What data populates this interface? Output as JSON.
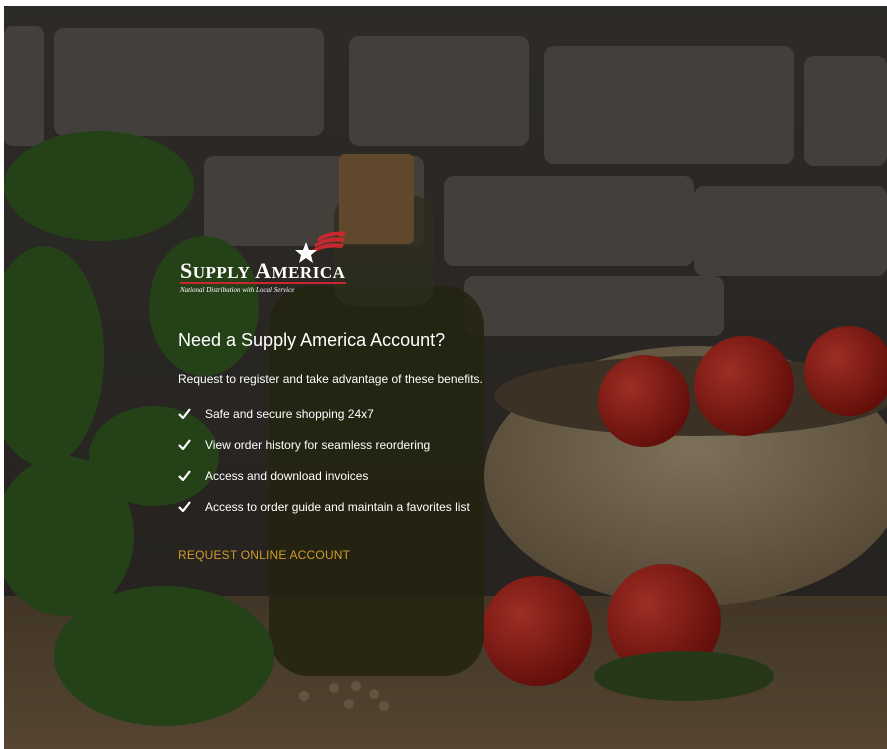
{
  "brand": {
    "name": "SUPPLY AMERICA",
    "tagline": "National Distribution with Local Service"
  },
  "panel": {
    "heading": "Need a Supply America Account?",
    "intro": "Request to register and take advantage of these benefits.",
    "benefits": [
      "Safe and secure shopping 24x7",
      "View order history for seamless reordering",
      "Access and download invoices",
      "Access to order guide and maintain a favorites list"
    ],
    "cta_label": "REQUEST ONLINE ACCOUNT"
  },
  "colors": {
    "accent": "#d29a2a",
    "logo_red": "#c8272d",
    "text": "#ffffff"
  },
  "icons": {
    "benefit": "check-icon",
    "logo_mark": "star-flag-icon"
  }
}
